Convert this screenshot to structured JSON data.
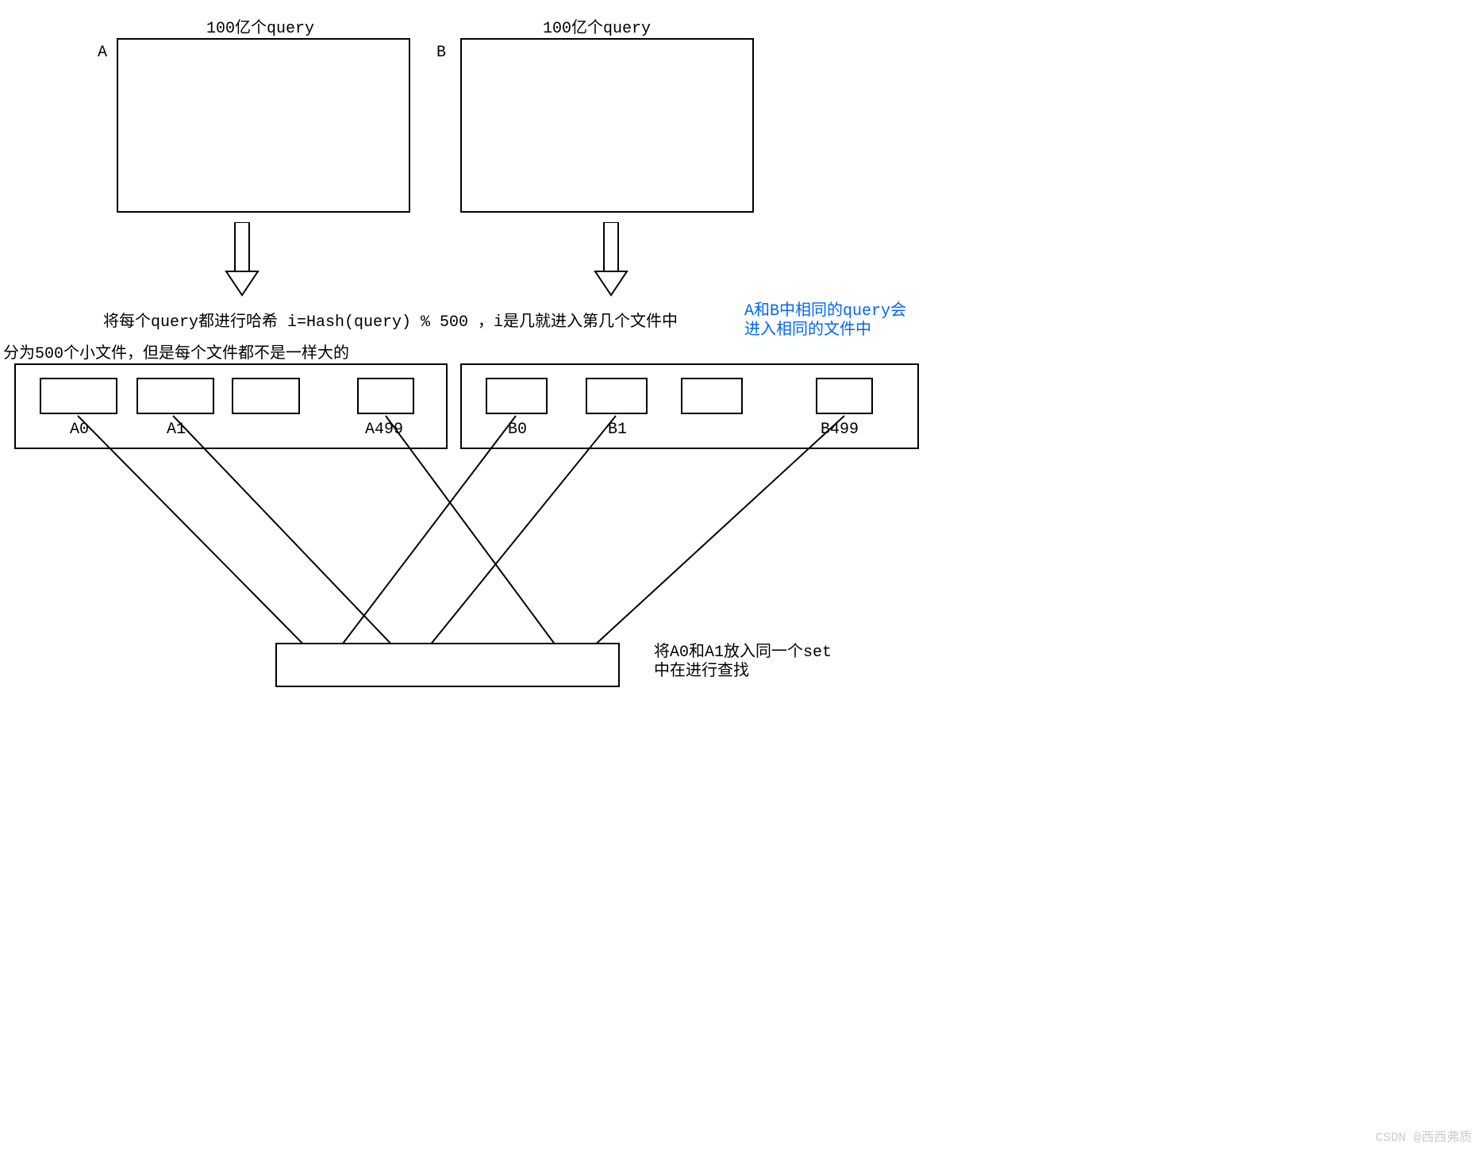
{
  "titles": {
    "topA": "100亿个query",
    "topB": "100亿个query"
  },
  "labels": {
    "A": "A",
    "B": "B"
  },
  "hashText": "将每个query都进行哈希  i=Hash(query) % 500 ，i是几就进入第几个文件中",
  "blueText1": "A和B中相同的query会",
  "blueText2": "进入相同的文件中",
  "splitText": "分为500个小文件，但是每个文件都不是一样大的",
  "fileLabels": {
    "A0": "A0",
    "A1": "A1",
    "A499": "A499",
    "B0": "B0",
    "B1": "B1",
    "B499": "B499"
  },
  "bottomText1": "将A0和A1放入同一个set",
  "bottomText2": "中在进行查找",
  "watermark": "CSDN @西西弗质"
}
